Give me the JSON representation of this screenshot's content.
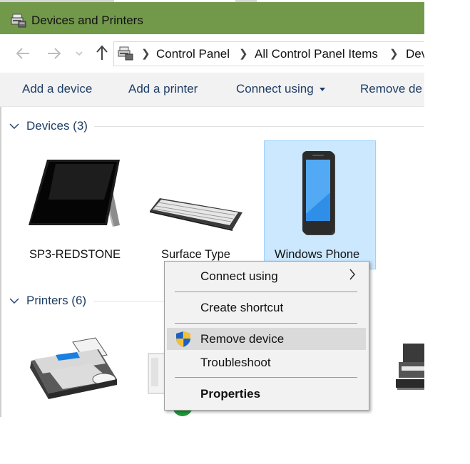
{
  "window": {
    "title": "Devices and Printers"
  },
  "address": {
    "breadcrumbs": [
      "Control Panel",
      "All Control Panel Items",
      "Dev"
    ]
  },
  "toolbar": {
    "add_device": "Add a device",
    "add_printer": "Add a printer",
    "connect_using": "Connect using",
    "remove_device": "Remove de"
  },
  "groups": {
    "devices": {
      "label": "Devices (3)"
    },
    "printers": {
      "label": "Printers (6)"
    }
  },
  "devices": [
    {
      "name": "SP3-REDSTONE",
      "icon": "tablet-icon"
    },
    {
      "name": "Surface Type",
      "icon": "keyboard-icon"
    },
    {
      "name": "Windows Phone",
      "icon": "phone-icon",
      "selected": true
    }
  ],
  "context_menu": {
    "items": [
      {
        "label": "Connect using",
        "submenu": true
      },
      {
        "label": "Create shortcut"
      },
      {
        "label": "Remove device",
        "icon": "uac-shield-icon",
        "highlighted": true
      },
      {
        "label": "Troubleshoot"
      },
      {
        "label": "Properties",
        "bold": true
      }
    ]
  },
  "colors": {
    "titlebar": "#72994a",
    "command_text": "#1e3e66",
    "selection_fill": "#cce8ff",
    "menu_bg": "#f2f2f2"
  }
}
